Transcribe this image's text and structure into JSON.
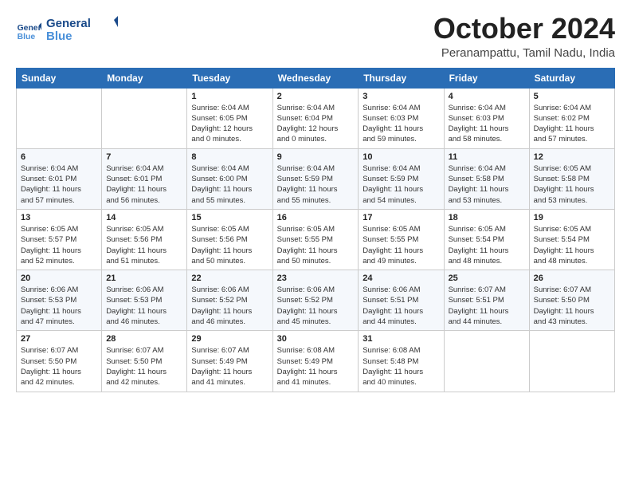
{
  "logo": {
    "line1": "General",
    "line2": "Blue"
  },
  "title": "October 2024",
  "subtitle": "Peranampattu, Tamil Nadu, India",
  "days_header": [
    "Sunday",
    "Monday",
    "Tuesday",
    "Wednesday",
    "Thursday",
    "Friday",
    "Saturday"
  ],
  "weeks": [
    [
      {
        "day": "",
        "info": ""
      },
      {
        "day": "",
        "info": ""
      },
      {
        "day": "1",
        "info": "Sunrise: 6:04 AM\nSunset: 6:05 PM\nDaylight: 12 hours\nand 0 minutes."
      },
      {
        "day": "2",
        "info": "Sunrise: 6:04 AM\nSunset: 6:04 PM\nDaylight: 12 hours\nand 0 minutes."
      },
      {
        "day": "3",
        "info": "Sunrise: 6:04 AM\nSunset: 6:03 PM\nDaylight: 11 hours\nand 59 minutes."
      },
      {
        "day": "4",
        "info": "Sunrise: 6:04 AM\nSunset: 6:03 PM\nDaylight: 11 hours\nand 58 minutes."
      },
      {
        "day": "5",
        "info": "Sunrise: 6:04 AM\nSunset: 6:02 PM\nDaylight: 11 hours\nand 57 minutes."
      }
    ],
    [
      {
        "day": "6",
        "info": "Sunrise: 6:04 AM\nSunset: 6:01 PM\nDaylight: 11 hours\nand 57 minutes."
      },
      {
        "day": "7",
        "info": "Sunrise: 6:04 AM\nSunset: 6:01 PM\nDaylight: 11 hours\nand 56 minutes."
      },
      {
        "day": "8",
        "info": "Sunrise: 6:04 AM\nSunset: 6:00 PM\nDaylight: 11 hours\nand 55 minutes."
      },
      {
        "day": "9",
        "info": "Sunrise: 6:04 AM\nSunset: 5:59 PM\nDaylight: 11 hours\nand 55 minutes."
      },
      {
        "day": "10",
        "info": "Sunrise: 6:04 AM\nSunset: 5:59 PM\nDaylight: 11 hours\nand 54 minutes."
      },
      {
        "day": "11",
        "info": "Sunrise: 6:04 AM\nSunset: 5:58 PM\nDaylight: 11 hours\nand 53 minutes."
      },
      {
        "day": "12",
        "info": "Sunrise: 6:05 AM\nSunset: 5:58 PM\nDaylight: 11 hours\nand 53 minutes."
      }
    ],
    [
      {
        "day": "13",
        "info": "Sunrise: 6:05 AM\nSunset: 5:57 PM\nDaylight: 11 hours\nand 52 minutes."
      },
      {
        "day": "14",
        "info": "Sunrise: 6:05 AM\nSunset: 5:56 PM\nDaylight: 11 hours\nand 51 minutes."
      },
      {
        "day": "15",
        "info": "Sunrise: 6:05 AM\nSunset: 5:56 PM\nDaylight: 11 hours\nand 50 minutes."
      },
      {
        "day": "16",
        "info": "Sunrise: 6:05 AM\nSunset: 5:55 PM\nDaylight: 11 hours\nand 50 minutes."
      },
      {
        "day": "17",
        "info": "Sunrise: 6:05 AM\nSunset: 5:55 PM\nDaylight: 11 hours\nand 49 minutes."
      },
      {
        "day": "18",
        "info": "Sunrise: 6:05 AM\nSunset: 5:54 PM\nDaylight: 11 hours\nand 48 minutes."
      },
      {
        "day": "19",
        "info": "Sunrise: 6:05 AM\nSunset: 5:54 PM\nDaylight: 11 hours\nand 48 minutes."
      }
    ],
    [
      {
        "day": "20",
        "info": "Sunrise: 6:06 AM\nSunset: 5:53 PM\nDaylight: 11 hours\nand 47 minutes."
      },
      {
        "day": "21",
        "info": "Sunrise: 6:06 AM\nSunset: 5:53 PM\nDaylight: 11 hours\nand 46 minutes."
      },
      {
        "day": "22",
        "info": "Sunrise: 6:06 AM\nSunset: 5:52 PM\nDaylight: 11 hours\nand 46 minutes."
      },
      {
        "day": "23",
        "info": "Sunrise: 6:06 AM\nSunset: 5:52 PM\nDaylight: 11 hours\nand 45 minutes."
      },
      {
        "day": "24",
        "info": "Sunrise: 6:06 AM\nSunset: 5:51 PM\nDaylight: 11 hours\nand 44 minutes."
      },
      {
        "day": "25",
        "info": "Sunrise: 6:07 AM\nSunset: 5:51 PM\nDaylight: 11 hours\nand 44 minutes."
      },
      {
        "day": "26",
        "info": "Sunrise: 6:07 AM\nSunset: 5:50 PM\nDaylight: 11 hours\nand 43 minutes."
      }
    ],
    [
      {
        "day": "27",
        "info": "Sunrise: 6:07 AM\nSunset: 5:50 PM\nDaylight: 11 hours\nand 42 minutes."
      },
      {
        "day": "28",
        "info": "Sunrise: 6:07 AM\nSunset: 5:50 PM\nDaylight: 11 hours\nand 42 minutes."
      },
      {
        "day": "29",
        "info": "Sunrise: 6:07 AM\nSunset: 5:49 PM\nDaylight: 11 hours\nand 41 minutes."
      },
      {
        "day": "30",
        "info": "Sunrise: 6:08 AM\nSunset: 5:49 PM\nDaylight: 11 hours\nand 41 minutes."
      },
      {
        "day": "31",
        "info": "Sunrise: 6:08 AM\nSunset: 5:48 PM\nDaylight: 11 hours\nand 40 minutes."
      },
      {
        "day": "",
        "info": ""
      },
      {
        "day": "",
        "info": ""
      }
    ]
  ]
}
